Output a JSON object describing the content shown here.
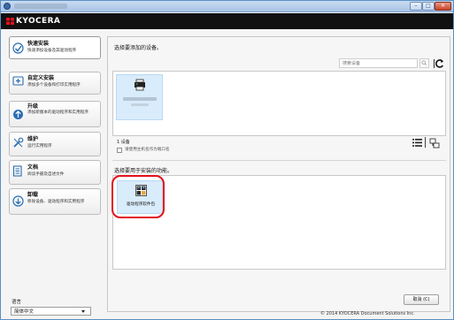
{
  "window": {
    "controls": {
      "minimize": "–",
      "maximize": "□",
      "close": "✕"
    }
  },
  "brand": {
    "logo_text": "KYOCERA",
    "colors": {
      "logo_red": "#e3101d",
      "bar": "#111111",
      "highlight": "#e3101d",
      "tile": "#d9ecfb"
    }
  },
  "sidebar": {
    "items": [
      {
        "title": "快速安装",
        "description": "快速添加设备及其驱动程序",
        "icon": "express-install-icon"
      },
      {
        "title": "自定义安装",
        "description": "添加多个设备和打印实用程序",
        "icon": "custom-install-icon"
      },
      {
        "title": "升级",
        "description": "添加新版本的驱动程序和实用程序",
        "icon": "upgrade-icon"
      },
      {
        "title": "维护",
        "description": "运行实用程序",
        "icon": "maintenance-icon"
      },
      {
        "title": "文档",
        "description": "阅读手册及自述文件",
        "icon": "documents-icon"
      },
      {
        "title": "卸载",
        "description": "移除设备、驱动程序和实用程序",
        "icon": "uninstall-icon"
      }
    ],
    "language_label": "语言",
    "language_value": "简体中文"
  },
  "main": {
    "select_device_title": "选择要添加的设备。",
    "search_placeholder": "搜索设备",
    "device_count": "1 设备",
    "use_hostname_label": "请使用主机名作为端口名",
    "select_feature_title": "选择要用于安装的功能。",
    "feature_label": "驱动程序软件包",
    "cancel_label": "取消 (C)",
    "copyright": "© 2014 KYOCERA Document Solutions Inc."
  }
}
